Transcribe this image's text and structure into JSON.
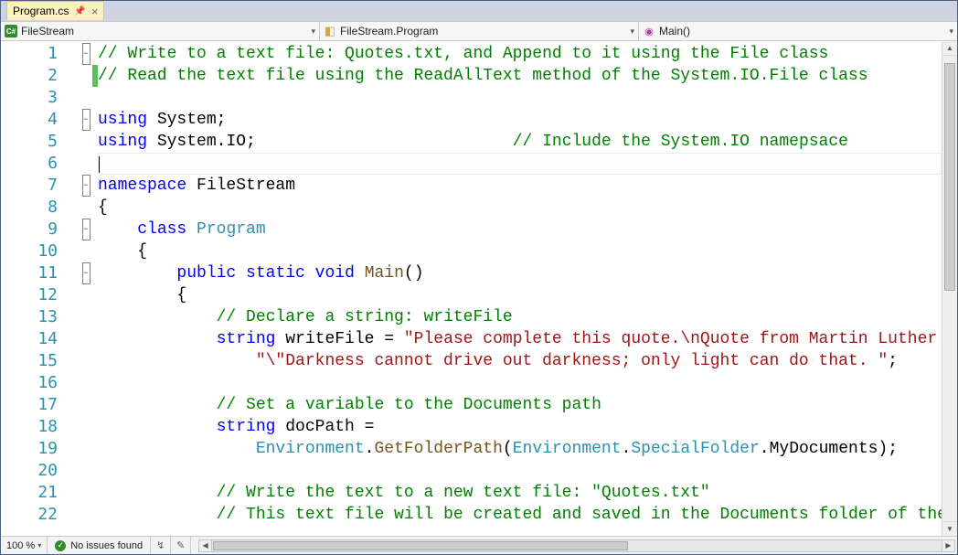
{
  "tab": {
    "filename": "Program.cs"
  },
  "nav": {
    "project": "FileStream",
    "class": "FileStream.Program",
    "method": "Main()"
  },
  "status": {
    "zoom": "100 %",
    "issues": "No issues found"
  },
  "code": {
    "lines": [
      {
        "n": 1,
        "fold": "-",
        "mod": false,
        "cls": "",
        "html": "<span class='cmt'>// Write to a text file: Quotes.txt, and Append to it using the File class</span>"
      },
      {
        "n": 2,
        "fold": "",
        "mod": true,
        "cls": "",
        "html": "<span class='cmt'>// Read the text file using the ReadAllText method of the System.IO.File class</span>"
      },
      {
        "n": 3,
        "fold": "",
        "mod": false,
        "cls": "",
        "html": ""
      },
      {
        "n": 4,
        "fold": "-",
        "mod": false,
        "cls": "",
        "html": "<span class='kw'>using</span> System;"
      },
      {
        "n": 5,
        "fold": "",
        "mod": false,
        "cls": "",
        "html": "<span class='kw'>using</span> System.IO;                          <span class='cmt'>// Include the System.IO namepsace</span>"
      },
      {
        "n": 6,
        "fold": "",
        "mod": false,
        "cls": "cur",
        "html": "<span class='caret'></span>"
      },
      {
        "n": 7,
        "fold": "-",
        "mod": false,
        "cls": "",
        "html": "<span class='kw'>namespace</span> FileStream"
      },
      {
        "n": 8,
        "fold": "",
        "mod": false,
        "cls": "",
        "html": "{"
      },
      {
        "n": 9,
        "fold": "-",
        "mod": false,
        "cls": "",
        "html": "    <span class='kw'>class</span> <span class='cls'>Program</span>"
      },
      {
        "n": 10,
        "fold": "",
        "mod": false,
        "cls": "",
        "html": "    {"
      },
      {
        "n": 11,
        "fold": "-",
        "mod": false,
        "cls": "",
        "html": "        <span class='kw'>public</span> <span class='kw'>static</span> <span class='kw'>void</span> <span class='mth'>Main</span>()"
      },
      {
        "n": 12,
        "fold": "",
        "mod": false,
        "cls": "",
        "html": "        {"
      },
      {
        "n": 13,
        "fold": "",
        "mod": false,
        "cls": "",
        "html": "            <span class='cmt'>// Declare a string: writeFile</span>"
      },
      {
        "n": 14,
        "fold": "",
        "mod": false,
        "cls": "",
        "html": "            <span class='kw'>string</span> writeFile = <span class='str'>\"Please complete this quote.\\nQuote from Martin Luther King Jr.: \"</span> +"
      },
      {
        "n": 15,
        "fold": "",
        "mod": false,
        "cls": "",
        "html": "                <span class='str'>\"\\\"Darkness cannot drive out darkness; only light can do that. \"</span>;"
      },
      {
        "n": 16,
        "fold": "",
        "mod": false,
        "cls": "",
        "html": ""
      },
      {
        "n": 17,
        "fold": "",
        "mod": false,
        "cls": "",
        "html": "            <span class='cmt'>// Set a variable to the Documents path</span>"
      },
      {
        "n": 18,
        "fold": "",
        "mod": false,
        "cls": "",
        "html": "            <span class='kw'>string</span> docPath ="
      },
      {
        "n": 19,
        "fold": "",
        "mod": false,
        "cls": "",
        "html": "                <span class='cls'>Environment</span>.<span class='mth'>GetFolderPath</span>(<span class='cls'>Environment</span>.<span class='cls'>SpecialFolder</span>.MyDocuments);"
      },
      {
        "n": 20,
        "fold": "",
        "mod": false,
        "cls": "",
        "html": ""
      },
      {
        "n": 21,
        "fold": "",
        "mod": false,
        "cls": "",
        "html": "            <span class='cmt'>// Write the text to a new text file: \"Quotes.txt\"</span>"
      },
      {
        "n": 22,
        "fold": "",
        "mod": false,
        "cls": "",
        "html": "            <span class='cmt'>// This text file will be created and saved in the Documents folder of the C: drive</span>"
      }
    ]
  }
}
